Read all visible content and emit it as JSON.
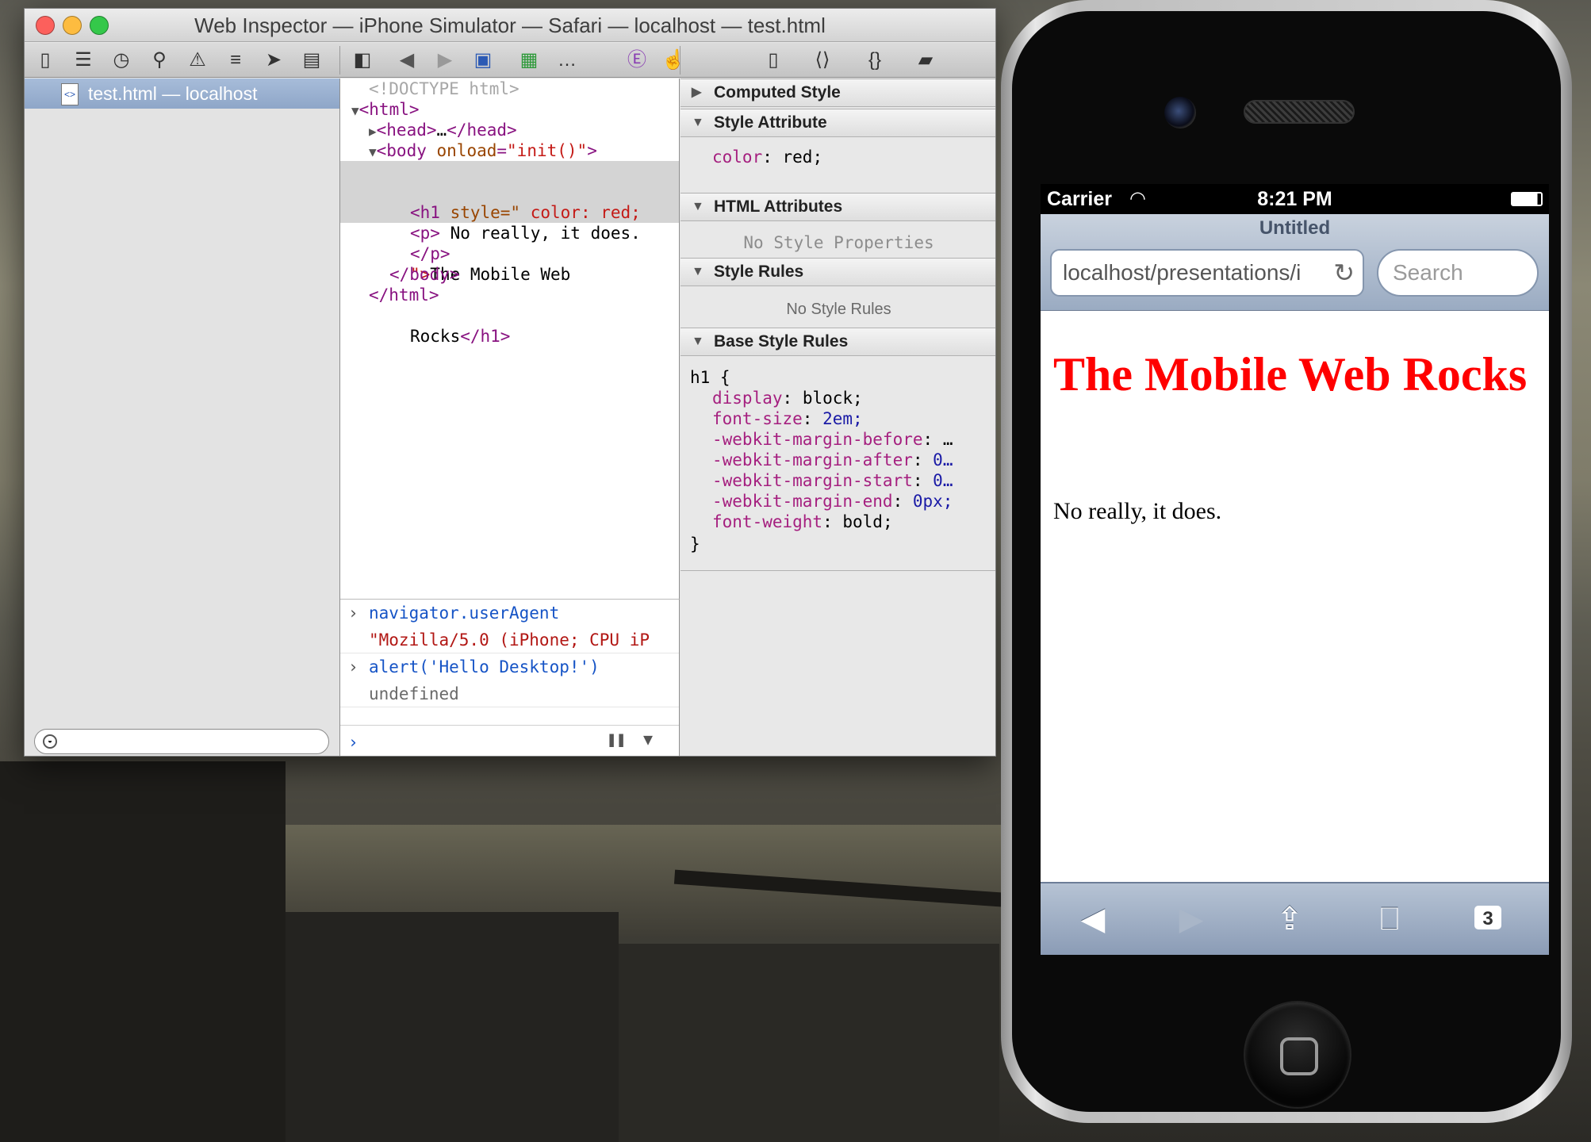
{
  "window": {
    "title": "Web Inspector — iPhone Simulator — Safari — localhost — test.html"
  },
  "toolbar": {
    "icons": [
      "resources-icon",
      "database-icon",
      "timeline-icon",
      "search-icon",
      "warning-icon",
      "log-icon",
      "tag-icon",
      "console-icon",
      "sidebar-toggle-icon",
      "back-icon",
      "forward-icon",
      "html-document-icon",
      "dom-node-icon",
      "element-icon",
      "inspect-pointer-icon",
      "page-icon",
      "markup-icon",
      "braces-icon",
      "ruler-icon"
    ],
    "breadcrumb_ellipsis": "…"
  },
  "resources": {
    "selected_item": "test.html — localhost",
    "file_icon_glyph": "<>"
  },
  "dom": {
    "lines": [
      {
        "indent": 1,
        "arrow": "",
        "text": "<!DOCTYPE html>"
      },
      {
        "indent": 0,
        "arrow": "▼",
        "tag_open": "<html>"
      },
      {
        "indent": 1,
        "arrow": "▶",
        "tag_open": "<head>",
        "middle": "…",
        "tag_close": "</head>"
      },
      {
        "indent": 1,
        "arrow": "▼",
        "tag_open": "<body",
        "attr": "onload",
        "eq": "=",
        "value": "\"init()\"",
        "end": ">"
      },
      {
        "indent": 2,
        "text_a": "<h1 ",
        "attr": "style=\"",
        "value": " color: red;"
      },
      {
        "indent": 2,
        "text_a": "\">",
        "text_b": "The Mobile Web"
      },
      {
        "indent": 2,
        "text_b": "Rocks",
        "tag_close": "</h1>"
      },
      {
        "indent": 2,
        "tag_open": "<p>",
        "text_b": " No really, it does."
      },
      {
        "indent": 2,
        "tag_close": "</p>"
      },
      {
        "indent": 1,
        "tag_close": "</body>"
      },
      {
        "indent": 0,
        "tag_close": "</html>"
      }
    ]
  },
  "console": {
    "entries": [
      {
        "kind": "input",
        "text": "navigator.userAgent"
      },
      {
        "kind": "output-string",
        "text": "\"Mozilla/5.0 (iPhone; CPU iP"
      },
      {
        "kind": "input",
        "text": "alert('Hello Desktop!')"
      },
      {
        "kind": "output",
        "text": "undefined"
      }
    ],
    "prompt_symbol": "›"
  },
  "sidebar": {
    "sections": [
      {
        "title": "Computed Style",
        "expanded": false
      },
      {
        "title": "Style Attribute",
        "expanded": true
      },
      {
        "title": "HTML Attributes",
        "expanded": true
      },
      {
        "title": "Style Rules",
        "expanded": true
      },
      {
        "title": "Base Style Rules",
        "expanded": true
      }
    ],
    "style_attribute": {
      "prop": "color",
      "value": "red"
    },
    "html_attributes_empty": "No Style Properties",
    "style_rules_empty": "No Style Rules",
    "base_rules": {
      "selector": "h1 {",
      "close": "}",
      "declarations": [
        {
          "prop": "display",
          "value": "block;"
        },
        {
          "prop": "font-size",
          "value": "2em;"
        },
        {
          "prop": "-webkit-margin-before",
          "value": "…"
        },
        {
          "prop": "-webkit-margin-after",
          "value": "0…"
        },
        {
          "prop": "-webkit-margin-start",
          "value": "0…"
        },
        {
          "prop": "-webkit-margin-end",
          "value": "0px;"
        },
        {
          "prop": "font-weight",
          "value": "bold;"
        }
      ]
    }
  },
  "phone": {
    "status": {
      "carrier": "Carrier",
      "time": "8:21 PM"
    },
    "page_title": "Untitled",
    "url": "localhost/presentations/i",
    "search_placeholder": "Search",
    "heading": "The Mobile Web Rocks",
    "paragraph": "No really, it does.",
    "tabs_count": "3"
  },
  "colors": {
    "tag": "#881280",
    "attribute": "#994500",
    "value": "#1a1aa6",
    "heading": "#ff0000",
    "selection": "#8ea6c8"
  }
}
